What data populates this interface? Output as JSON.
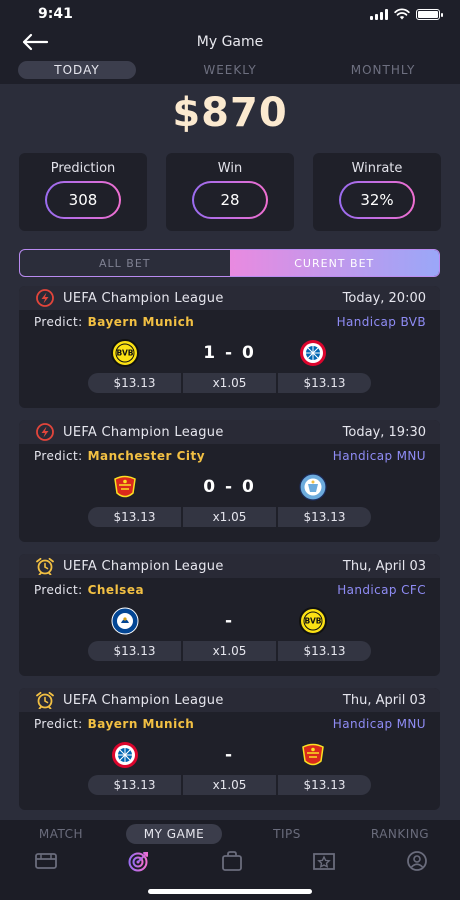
{
  "status_bar": {
    "time": "9:41"
  },
  "header": {
    "title": "My Game"
  },
  "period_tabs": [
    {
      "label": "TODAY",
      "active": true
    },
    {
      "label": "WEEKLY",
      "active": false
    },
    {
      "label": "MONTHLY",
      "active": false
    }
  ],
  "balance": "$870",
  "stats": [
    {
      "label": "Prediction",
      "value": "308"
    },
    {
      "label": "Win",
      "value": "28"
    },
    {
      "label": "Winrate",
      "value": "32%"
    }
  ],
  "bet_tabs": [
    {
      "label": "ALL BET",
      "active": false
    },
    {
      "label": "CURENT BET",
      "active": true
    }
  ],
  "predict_label": "Predict:",
  "matches": [
    {
      "icon": "lightning-icon",
      "league": "UEFA Champion League",
      "time": "Today, 20:00",
      "predict": "Bayern Munich",
      "handicap": "Handicap BVB",
      "home": "bvb-logo",
      "away": "bayern-logo",
      "score": "1 - 0",
      "odds": [
        "$13.13",
        "x1.05",
        "$13.13"
      ]
    },
    {
      "icon": "lightning-icon",
      "league": "UEFA Champion League",
      "time": "Today, 19:30",
      "predict": "Manchester City",
      "handicap": "Handicap MNU",
      "home": "manutd-logo",
      "away": "mancity-logo",
      "score": "0 - 0",
      "odds": [
        "$13.13",
        "x1.05",
        "$13.13"
      ]
    },
    {
      "icon": "alarm-icon",
      "league": "UEFA Champion League",
      "time": "Thu, April 03",
      "predict": "Chelsea",
      "handicap": "Handicap CFC",
      "home": "chelsea-logo",
      "away": "bvb-logo",
      "score": "-",
      "odds": [
        "$13.13",
        "x1.05",
        "$13.13"
      ]
    },
    {
      "icon": "alarm-icon",
      "league": "UEFA Champion League",
      "time": "Thu, April 03",
      "predict": "Bayern Munich",
      "handicap": "Handicap MNU",
      "home": "bayern-logo",
      "away": "manutd-logo",
      "score": "-",
      "odds": [
        "$13.13",
        "x1.05",
        "$13.13"
      ]
    }
  ],
  "bottom_nav": [
    {
      "label": "MATCH",
      "icon": "ticket-icon",
      "active": false
    },
    {
      "label": "MY GAME",
      "icon": "target-icon",
      "active": true
    },
    {
      "label": "TIPS",
      "icon": "bag-icon",
      "active": false
    },
    {
      "label": "RANKING",
      "icon": "star-board-icon",
      "active": false
    },
    {
      "label": "",
      "icon": "profile-icon",
      "active": false
    }
  ],
  "colors": {
    "accent_gold": "#f2c043",
    "accent_purple": "#8f8cf5",
    "amount": "#fbe9cf",
    "background": "#2b2d3a"
  }
}
